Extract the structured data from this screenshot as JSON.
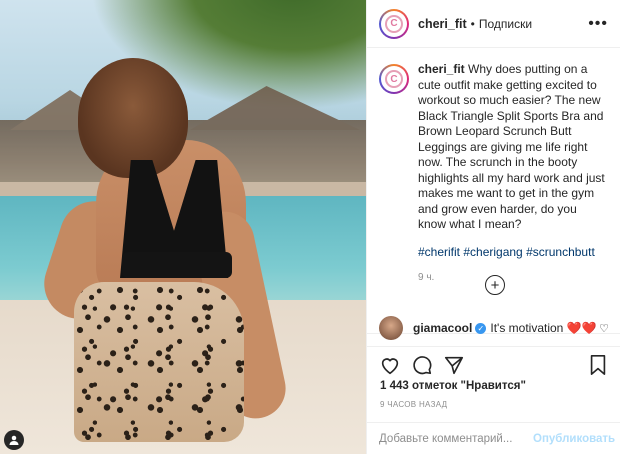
{
  "post": {
    "username": "cheri_fit",
    "separator": "•",
    "follow_label": "Подписки",
    "more_icon": "ellipsis-icon"
  },
  "caption": {
    "username": "cheri_fit",
    "text": "Why does putting on a cute outfit make getting excited to workout so much easier? The new Black Triangle Split Sports Bra and Brown Leopard Scrunch Butt Leggings are giving me life right now. The scrunch in the booty highlights all my hard work and just makes me want to get in the gym and grow even harder, do you know what I mean?",
    "hashtags": "#cherifit #cherigang #scrunchbutt",
    "time": "9 ч."
  },
  "comments": [
    {
      "username": "giamacool",
      "text": "It's motivation ❤️❤️"
    }
  ],
  "actions": {
    "like_icon": "heart-icon",
    "comment_icon": "comment-icon",
    "share_icon": "send-icon",
    "save_icon": "bookmark-icon"
  },
  "likes": "1 443 отметок \"Нравится\"",
  "posted_ago": "9 ЧАСОВ НАЗАД",
  "comment_box": {
    "placeholder": "Добавьте комментарий...",
    "publish_label": "Опубликовать"
  }
}
